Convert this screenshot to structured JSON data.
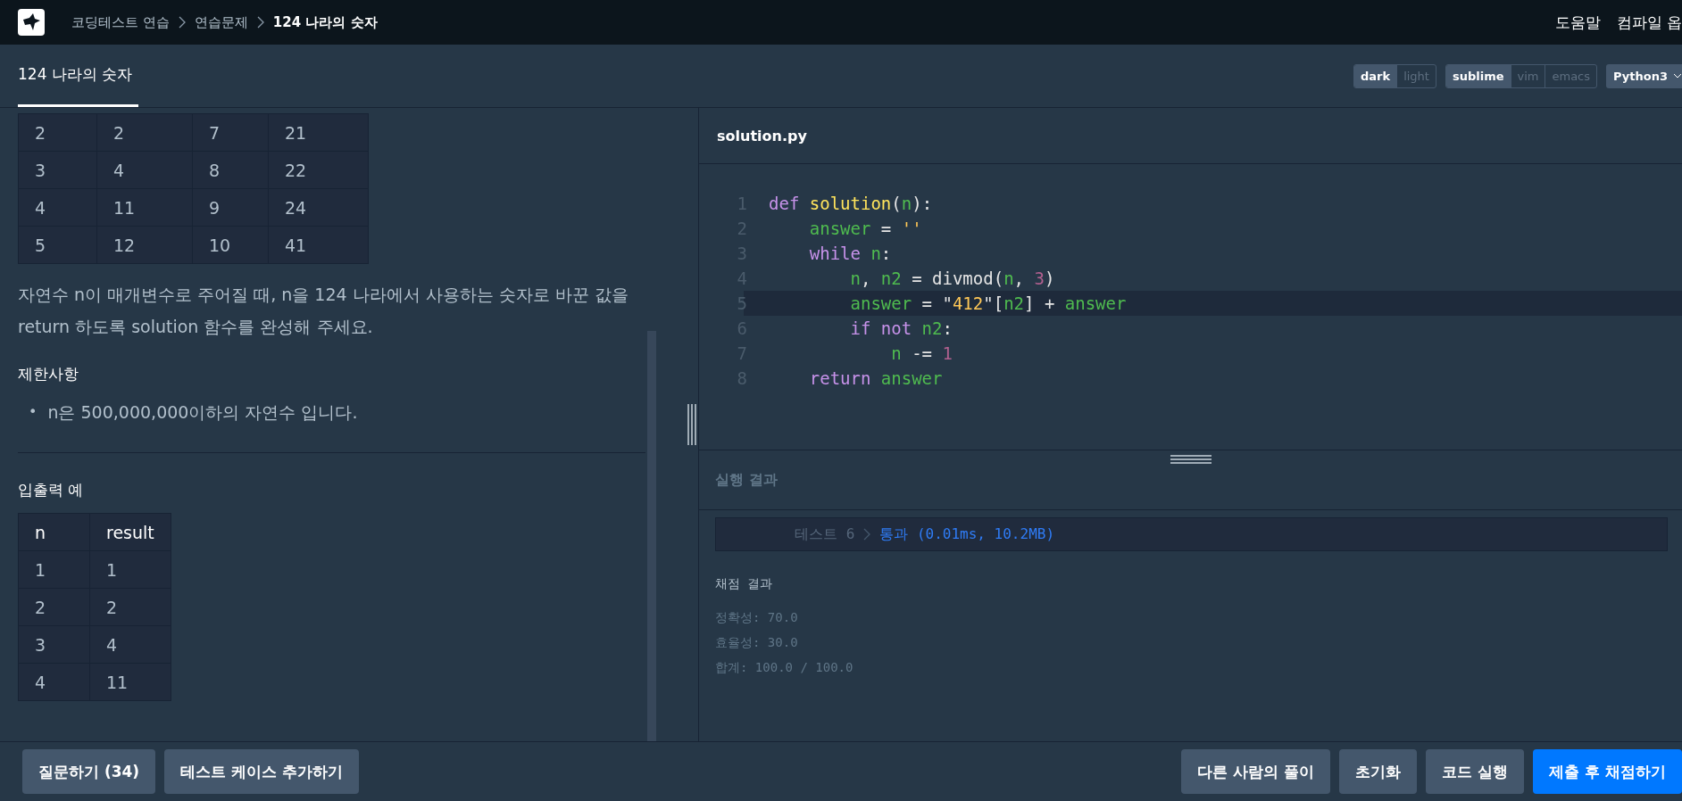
{
  "nav": {
    "breadcrumb": [
      {
        "label": "코딩테스트 연습",
        "current": false
      },
      {
        "label": "연습문제",
        "current": false
      },
      {
        "label": "124 나라의 숫자",
        "current": true
      }
    ],
    "links": [
      "도움말",
      "컴파일 옵"
    ]
  },
  "header": {
    "tabs": [
      {
        "label": "124 나라의 숫자",
        "selected": true
      }
    ],
    "themes": [
      {
        "label": "dark",
        "selected": true
      },
      {
        "label": "light",
        "selected": false
      }
    ],
    "keymaps": [
      {
        "label": "sublime",
        "selected": true
      },
      {
        "label": "vim",
        "selected": false
      },
      {
        "label": "emacs",
        "selected": false
      }
    ],
    "language": "Python3"
  },
  "problem": {
    "table_rows": [
      [
        "2",
        "2",
        "7",
        "21"
      ],
      [
        "3",
        "4",
        "8",
        "22"
      ],
      [
        "4",
        "11",
        "9",
        "24"
      ],
      [
        "5",
        "12",
        "10",
        "41"
      ]
    ],
    "description": "자연수 n이 매개변수로 주어질 때, n을 124 나라에서 사용하는 숫자로 바꾼 값을 return 하도록 solution 함수를 완성해 주세요.",
    "constraints_title": "제한사항",
    "constraints": [
      {
        "bullet": "•",
        "text": "n은 500,000,000이하의 자연수 입니다."
      }
    ],
    "examples_title": "입출력 예",
    "examples": {
      "columns": [
        "n",
        "result"
      ],
      "rows": [
        [
          "1",
          "1"
        ],
        [
          "2",
          "2"
        ],
        [
          "3",
          "4"
        ],
        [
          "4",
          "11"
        ]
      ]
    }
  },
  "editor": {
    "filename": "solution.py",
    "lines": [
      {
        "number": "1",
        "highlighted": false,
        "tokens": [
          {
            "text": "def ",
            "kind": "kw"
          },
          {
            "text": "solution",
            "kind": "fn"
          },
          {
            "text": "(",
            "kind": "punct"
          },
          {
            "text": "n",
            "kind": "var"
          },
          {
            "text": "):",
            "kind": "punct"
          }
        ]
      },
      {
        "number": "2",
        "highlighted": false,
        "tokens": [
          {
            "text": "    answer",
            "kind": "var"
          },
          {
            "text": " = ",
            "kind": "punct"
          },
          {
            "text": "''",
            "kind": "str"
          }
        ]
      },
      {
        "number": "3",
        "highlighted": false,
        "tokens": [
          {
            "text": "    while ",
            "kind": "kw"
          },
          {
            "text": "n",
            "kind": "var"
          },
          {
            "text": ":",
            "kind": "punct"
          }
        ]
      },
      {
        "number": "4",
        "highlighted": false,
        "tokens": [
          {
            "text": "        n",
            "kind": "var"
          },
          {
            "text": ", ",
            "kind": "punct"
          },
          {
            "text": "n2",
            "kind": "var"
          },
          {
            "text": " = divmod(",
            "kind": "punct"
          },
          {
            "text": "n",
            "kind": "var"
          },
          {
            "text": ", ",
            "kind": "punct"
          },
          {
            "text": "3",
            "kind": "num"
          },
          {
            "text": ")",
            "kind": "punct"
          }
        ]
      },
      {
        "number": "5",
        "highlighted": true,
        "tokens": [
          {
            "text": "        answer",
            "kind": "var"
          },
          {
            "text": " = \"",
            "kind": "punct"
          },
          {
            "text": "412",
            "kind": "str"
          },
          {
            "text": "\"[",
            "kind": "punct"
          },
          {
            "text": "n2",
            "kind": "var"
          },
          {
            "text": "] + ",
            "kind": "punct"
          },
          {
            "text": "answer",
            "kind": "var"
          }
        ]
      },
      {
        "number": "6",
        "highlighted": false,
        "tokens": [
          {
            "text": "        if not ",
            "kind": "kw"
          },
          {
            "text": "n2",
            "kind": "var"
          },
          {
            "text": ":",
            "kind": "punct"
          }
        ]
      },
      {
        "number": "7",
        "highlighted": false,
        "tokens": [
          {
            "text": "            n",
            "kind": "var"
          },
          {
            "text": " -= ",
            "kind": "punct"
          },
          {
            "text": "1",
            "kind": "num"
          }
        ]
      },
      {
        "number": "8",
        "highlighted": false,
        "tokens": [
          {
            "text": "    return ",
            "kind": "kw"
          },
          {
            "text": "answer",
            "kind": "var"
          }
        ]
      }
    ]
  },
  "results": {
    "title": "실행 결과",
    "tests": [
      {
        "label": "테스트 6",
        "result": "통과 (0.01ms, 10.2MB)"
      }
    ],
    "score_title": "채점 결과",
    "scores": [
      "정확성: 70.0",
      "효율성: 30.0",
      "합계: 100.0 / 100.0"
    ]
  },
  "footer": {
    "left_buttons": [
      {
        "label": "질문하기 (34)",
        "kind": "secondary"
      },
      {
        "label": "테스트 케이스 추가하기",
        "kind": "secondary"
      }
    ],
    "right_buttons": [
      {
        "label": "다른 사람의 풀이",
        "kind": "secondary"
      },
      {
        "label": "초기화",
        "kind": "secondary"
      },
      {
        "label": "코드 실행",
        "kind": "secondary"
      },
      {
        "label": "제출 후 채점하기",
        "kind": "primary"
      }
    ]
  }
}
